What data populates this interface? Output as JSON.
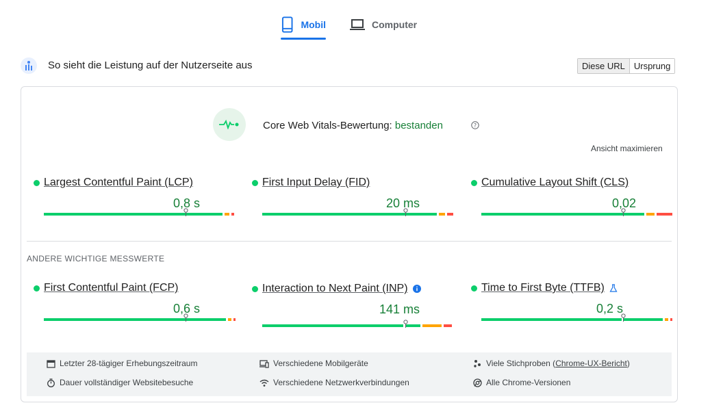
{
  "tabs": [
    {
      "label": "Mobil",
      "active": true
    },
    {
      "label": "Computer",
      "active": false
    }
  ],
  "header": {
    "title": "So sieht die Leistung auf der Nutzerseite aus",
    "segment": [
      "Diese URL",
      "Ursprung"
    ],
    "segment_selected": "Diese URL"
  },
  "cwv": {
    "label": "Core Web Vitals-Bewertung:",
    "status": "bestanden",
    "expand": "Ansicht maximieren"
  },
  "core_metrics": [
    {
      "name": "Largest Contentful Paint (LCP)",
      "value": "0,8 s",
      "rating": "good"
    },
    {
      "name": "First Input Delay (FID)",
      "value": "20 ms",
      "rating": "good"
    },
    {
      "name": "Cumulative Layout Shift (CLS)",
      "value": "0,02",
      "rating": "good"
    }
  ],
  "other_label": "ANDERE WICHTIGE MESSWERTE",
  "other_metrics": [
    {
      "name": "First Contentful Paint (FCP)",
      "value": "0,6 s",
      "rating": "good"
    },
    {
      "name": "Interaction to Next Paint (INP)",
      "value": "141 ms",
      "rating": "good",
      "icon": "info-icon"
    },
    {
      "name": "Time to First Byte (TTFB)",
      "value": "0,2 s",
      "rating": "good",
      "icon": "flask-icon"
    }
  ],
  "footer": {
    "period": "Letzter 28-tägiger Erhebungszeitraum",
    "duration": "Dauer vollständiger Websitebesuche",
    "devices": "Verschiedene Mobilgeräte",
    "network": "Verschiedene Netzwerkverbindungen",
    "samples_prefix": "Viele Stichproben (",
    "samples_link": "Chrome-UX-Bericht",
    "samples_suffix": ")",
    "versions": "Alle Chrome-Versionen"
  },
  "colors": {
    "accent": "#1a73e8",
    "good": "#0cce6b",
    "average": "#ffa400",
    "poor": "#ff4e42",
    "good_text": "#188038"
  }
}
